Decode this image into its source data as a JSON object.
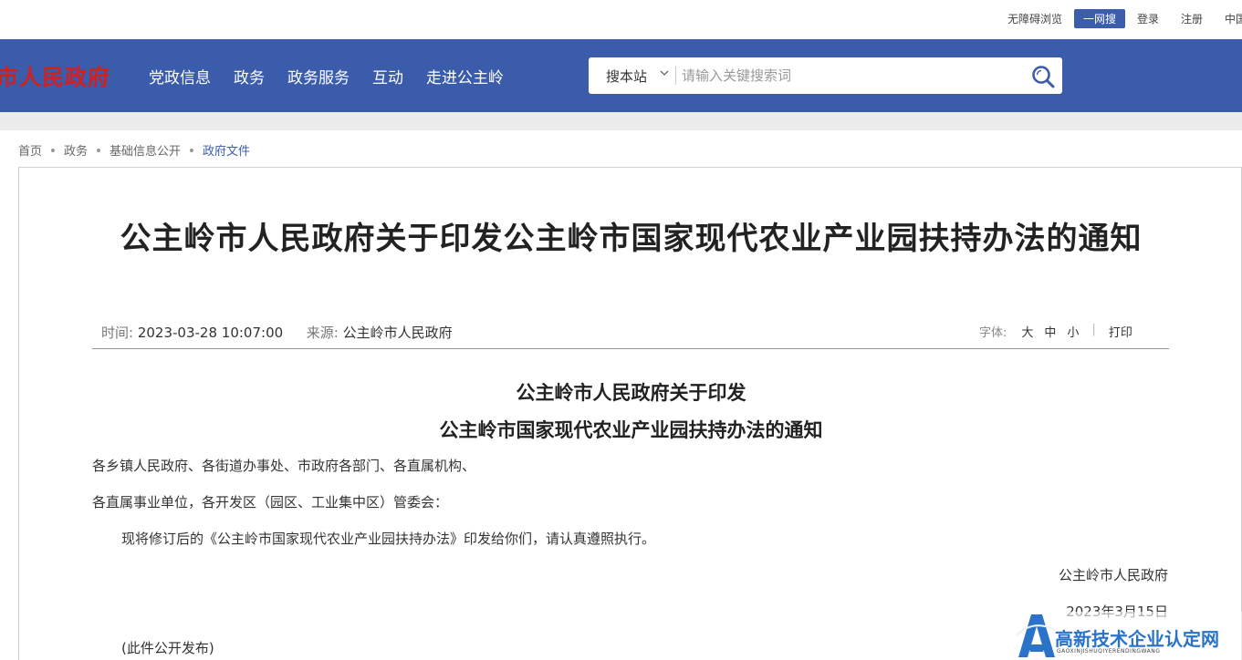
{
  "topbar": {
    "accessibility": "无障碍浏览",
    "one_search": "一网搜",
    "login": "登录",
    "register": "注册",
    "china": "中国"
  },
  "header": {
    "logo_text": "市人民政府",
    "nav": [
      "党政信息",
      "政务",
      "政务服务",
      "互动",
      "走进公主岭"
    ],
    "search": {
      "scope": "搜本站",
      "placeholder": "请输入关键搜索词"
    }
  },
  "breadcrumb": [
    "首页",
    "政务",
    "基础信息公开",
    "政府文件"
  ],
  "article": {
    "title": "公主岭市人民政府关于印发公主岭市国家现代农业产业园扶持办法的通知",
    "time_label": "时间:",
    "time_value": "2023-03-28 10:07:00",
    "source_label": "来源:",
    "source_value": "公主岭市人民政府",
    "font_label": "字体:",
    "font_large": "大",
    "font_medium": "中",
    "font_small": "小",
    "separator": "|",
    "print": "打印",
    "doc_heading_1": "公主岭市人民政府关于印发",
    "doc_heading_2": "公主岭市国家现代农业产业园扶持办法的通知",
    "addressee_1": "各乡镇人民政府、各街道办事处、市政府各部门、各直属机构、",
    "addressee_2": "各直属事业单位，各开发区（园区、工业集中区）管委会：",
    "body": "现将修订后的《公主岭市国家现代农业产业园扶持办法》印发给你们，请认真遵照执行。",
    "signature": "公主岭市人民政府",
    "date": "2023年3月15日",
    "note": "(此件公开发布)"
  },
  "watermark": {
    "text": "高新技术企业认定网",
    "sub": "GAOXINJISHUQIYERENDINGWANG"
  },
  "colors": {
    "header_blue": "#3a5cab",
    "logo_red": "#d51e1e",
    "watermark_blue": "#2a73c9"
  }
}
